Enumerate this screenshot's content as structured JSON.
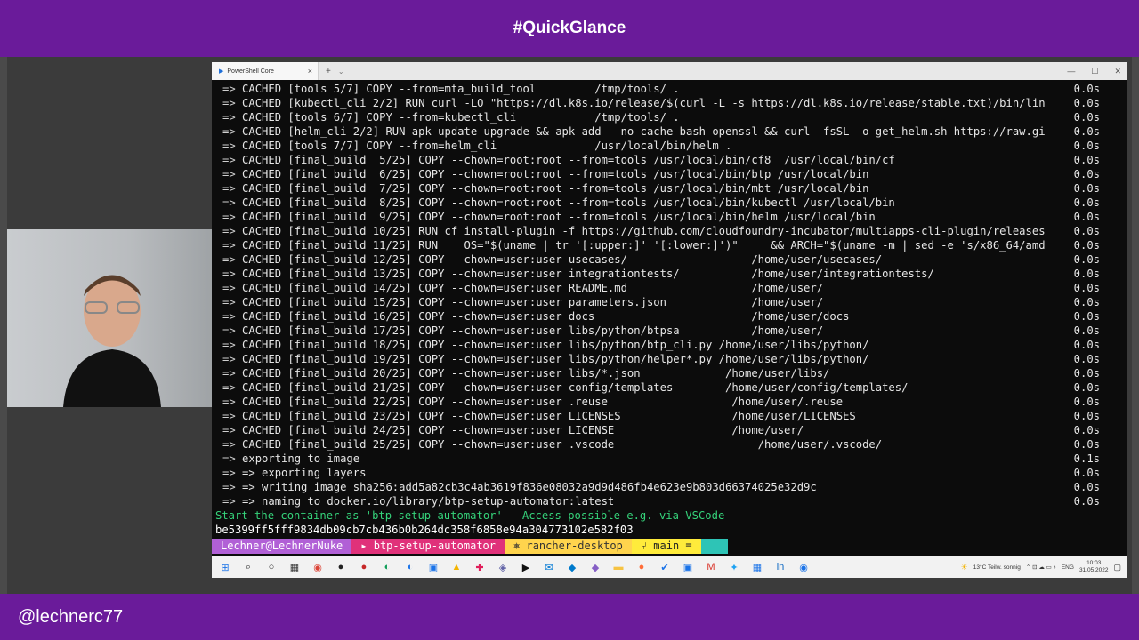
{
  "header": {
    "title": "#QuickGlance"
  },
  "footer": {
    "handle": "@lechnerc77"
  },
  "window": {
    "tab_title": "PowerShell Core",
    "new_tab": "+",
    "dropdown": "⌄"
  },
  "terminal": {
    "lines": [
      {
        "text": "CACHED [tools 5/7] COPY --from=mta_build_tool         /tmp/tools/ .",
        "time": "0.0s"
      },
      {
        "text": "CACHED [kubectl_cli 2/2] RUN curl -LO \"https://dl.k8s.io/release/$(curl -L -s https://dl.k8s.io/release/stable.txt)/bin/lin",
        "time": "0.0s"
      },
      {
        "text": "CACHED [tools 6/7] COPY --from=kubectl_cli            /tmp/tools/ .",
        "time": "0.0s"
      },
      {
        "text": "CACHED [helm_cli 2/2] RUN apk update upgrade && apk add --no-cache bash openssl && curl -fsSL -o get_helm.sh https://raw.gi",
        "time": "0.0s"
      },
      {
        "text": "CACHED [tools 7/7] COPY --from=helm_cli               /usr/local/bin/helm .",
        "time": "0.0s"
      },
      {
        "text": "CACHED [final_build  5/25] COPY --chown=root:root --from=tools /usr/local/bin/cf8  /usr/local/bin/cf",
        "time": "0.0s"
      },
      {
        "text": "CACHED [final_build  6/25] COPY --chown=root:root --from=tools /usr/local/bin/btp /usr/local/bin",
        "time": "0.0s"
      },
      {
        "text": "CACHED [final_build  7/25] COPY --chown=root:root --from=tools /usr/local/bin/mbt /usr/local/bin",
        "time": "0.0s"
      },
      {
        "text": "CACHED [final_build  8/25] COPY --chown=root:root --from=tools /usr/local/bin/kubectl /usr/local/bin",
        "time": "0.0s"
      },
      {
        "text": "CACHED [final_build  9/25] COPY --chown=root:root --from=tools /usr/local/bin/helm /usr/local/bin",
        "time": "0.0s"
      },
      {
        "text": "CACHED [final_build 10/25] RUN cf install-plugin -f https://github.com/cloudfoundry-incubator/multiapps-cli-plugin/releases",
        "time": "0.0s"
      },
      {
        "text": "CACHED [final_build 11/25] RUN    OS=\"$(uname | tr '[:upper:]' '[:lower:]')\"     && ARCH=\"$(uname -m | sed -e 's/x86_64/amd",
        "time": "0.0s"
      },
      {
        "text": "CACHED [final_build 12/25] COPY --chown=user:user usecases/                   /home/user/usecases/",
        "time": "0.0s"
      },
      {
        "text": "CACHED [final_build 13/25] COPY --chown=user:user integrationtests/           /home/user/integrationtests/",
        "time": "0.0s"
      },
      {
        "text": "CACHED [final_build 14/25] COPY --chown=user:user README.md                   /home/user/",
        "time": "0.0s"
      },
      {
        "text": "CACHED [final_build 15/25] COPY --chown=user:user parameters.json             /home/user/",
        "time": "0.0s"
      },
      {
        "text": "CACHED [final_build 16/25] COPY --chown=user:user docs                        /home/user/docs",
        "time": "0.0s"
      },
      {
        "text": "CACHED [final_build 17/25] COPY --chown=user:user libs/python/btpsa           /home/user/",
        "time": "0.0s"
      },
      {
        "text": "CACHED [final_build 18/25] COPY --chown=user:user libs/python/btp_cli.py /home/user/libs/python/",
        "time": "0.0s"
      },
      {
        "text": "CACHED [final_build 19/25] COPY --chown=user:user libs/python/helper*.py /home/user/libs/python/",
        "time": "0.0s"
      },
      {
        "text": "CACHED [final_build 20/25] COPY --chown=user:user libs/*.json             /home/user/libs/",
        "time": "0.0s"
      },
      {
        "text": "CACHED [final_build 21/25] COPY --chown=user:user config/templates        /home/user/config/templates/",
        "time": "0.0s"
      },
      {
        "text": "CACHED [final_build 22/25] COPY --chown=user:user .reuse                   /home/user/.reuse",
        "time": "0.0s"
      },
      {
        "text": "CACHED [final_build 23/25] COPY --chown=user:user LICENSES                 /home/user/LICENSES",
        "time": "0.0s"
      },
      {
        "text": "CACHED [final_build 24/25] COPY --chown=user:user LICENSE                  /home/user/",
        "time": "0.0s"
      },
      {
        "text": "CACHED [final_build 25/25] COPY --chown=user:user .vscode                      /home/user/.vscode/",
        "time": "0.0s"
      },
      {
        "text": "exporting to image",
        "time": "0.1s"
      },
      {
        "text": "=> exporting layers",
        "time": "0.0s"
      },
      {
        "text": "=> writing image sha256:add5a82cb3c4ab3619f836e08032a9d9d486fb4e623e9b803d66374025e32d9c",
        "time": "0.0s"
      },
      {
        "text": "=> naming to docker.io/library/btp-setup-automator:latest",
        "time": "0.0s"
      }
    ],
    "status_line": "Start the container as 'btp-setup-automator' - Access possible e.g. via VSCode",
    "container_id": "be5399ff5fff9834db09cb7cb436b0b264dc358f6858e94a304773102e582f03",
    "prompt": {
      "user": "Lechner@LechnerNuke",
      "folder": "btp-setup-automator",
      "k8s": "rancher-desktop",
      "git": "main ≡"
    }
  },
  "taskbar": {
    "weather": "13°C  Teilw. sonnig",
    "lang": "ENG",
    "time": "10:03",
    "date": "31.05.2022"
  },
  "colors": {
    "brand": "#6a1b9a",
    "terminal_bg": "#0c0c0c",
    "green": "#35d27a"
  }
}
